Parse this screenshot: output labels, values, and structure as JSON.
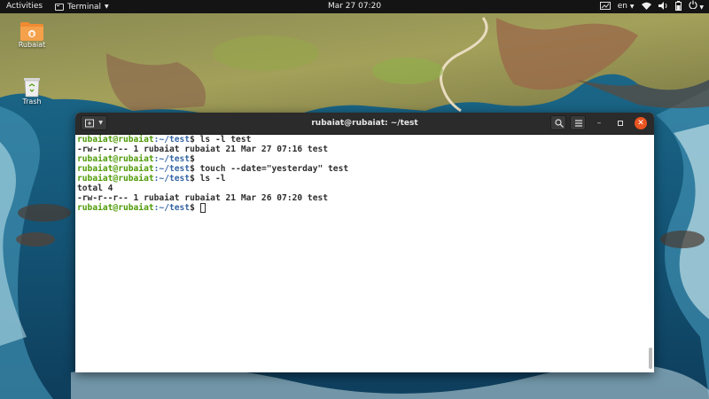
{
  "topbar": {
    "activities": "Activities",
    "app_name": "Terminal",
    "clock": "Mar 27  07:20",
    "language": "en"
  },
  "desktop": {
    "icons": [
      {
        "label": "Rubaiat",
        "icon": "folder-icon"
      },
      {
        "label": "Trash",
        "icon": "trash-icon"
      }
    ]
  },
  "terminal": {
    "title": "rubaiat@rubaiat: ~/test",
    "lines": [
      {
        "user": "rubaiat@rubaiat",
        "path": ":~/test",
        "cmd": "$ ls -l test"
      },
      {
        "text": "-rw-r--r-- 1 rubaiat rubaiat 21 Mar 27 07:16 test"
      },
      {
        "user": "rubaiat@rubaiat",
        "path": ":~/test",
        "cmd": "$"
      },
      {
        "user": "rubaiat@rubaiat",
        "path": ":~/test",
        "cmd": "$ touch --date=\"yesterday\" test"
      },
      {
        "user": "rubaiat@rubaiat",
        "path": ":~/test",
        "cmd": "$ ls -l"
      },
      {
        "text": "total 4"
      },
      {
        "text": "-rw-r--r-- 1 rubaiat rubaiat 21 Mar 26 07:20 test"
      },
      {
        "user": "rubaiat@rubaiat",
        "path": ":~/test",
        "cmd": "$ "
      }
    ]
  },
  "colors": {
    "prompt_user": "#4e9a06",
    "prompt_path": "#3465a4",
    "close_button": "#e95420",
    "folder": "#f08a30"
  }
}
